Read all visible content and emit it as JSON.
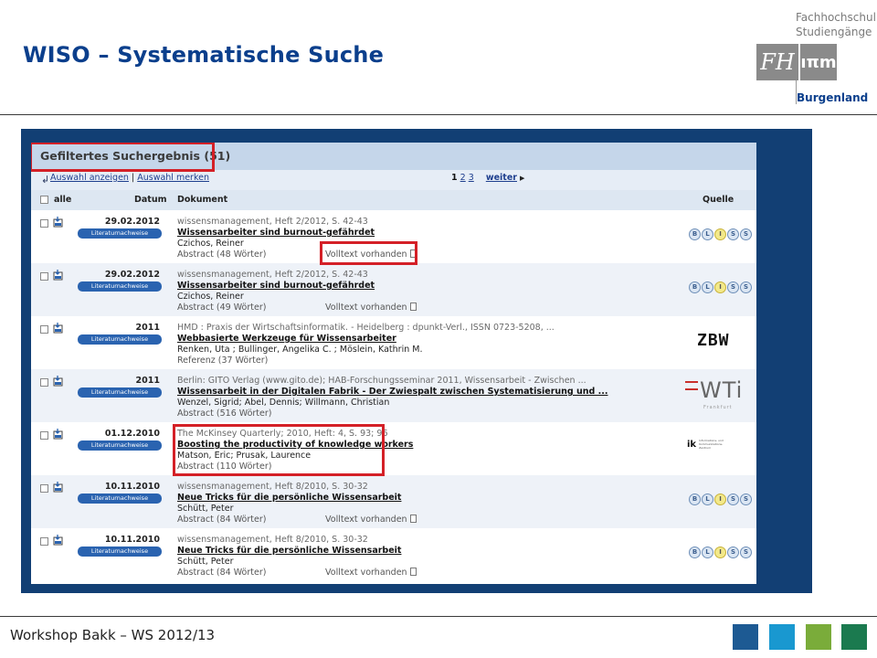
{
  "slide": {
    "title": "WISO – Systematische Suche",
    "footer": "Workshop Bakk – WS 2012/13",
    "logo": {
      "line1": "Fachhochschul",
      "line2": "Studiengänge",
      "box1": "FH",
      "box2": "ıπm",
      "line3": "Burgenland"
    },
    "footer_squares": [
      "#1d5a93",
      "#1998d0",
      "#7aac3a",
      "#1b7a4f"
    ]
  },
  "results": {
    "title": "Gefiltertes Suchergebnis (51)",
    "toolbar": {
      "show_selection": "Auswahl anzeigen",
      "separator": "|",
      "save_selection": "Auswahl merken"
    },
    "pager": {
      "current": "1",
      "page2": "2",
      "page3": "3",
      "next": "weiter"
    },
    "columns": {
      "all": "alle",
      "date": "Datum",
      "document": "Dokument",
      "source": "Quelle"
    },
    "badge": "Literaturnachweise",
    "fulltext_label": "Volltext vorhanden",
    "rows": [
      {
        "date": "29.02.2012",
        "source": "wissensmanagement, Heft 2/2012, S. 42-43",
        "title": "Wissensarbeiter sind burnout-gefährdet",
        "authors": "Czichos, Reiner",
        "abstract": "Abstract (48 Wörter)",
        "fulltext": "Volltext vorhanden",
        "quelle": "BLISS"
      },
      {
        "date": "29.02.2012",
        "source": "wissensmanagement, Heft 2/2012, S. 42-43",
        "title": "Wissensarbeiter sind burnout-gefährdet",
        "authors": "Czichos, Reiner",
        "abstract": "Abstract (49 Wörter)",
        "fulltext": "Volltext vorhanden",
        "quelle": "BLISS"
      },
      {
        "date": "2011",
        "source": "HMD : Praxis der Wirtschaftsinformatik. - Heidelberg : dpunkt-Verl., ISSN 0723-5208, ...",
        "title": "Webbasierte Werkzeuge für Wissensarbeiter",
        "authors": "Renken, Uta ; Bullinger, Angelika C. ; Möslein, Kathrin M.",
        "abstract": "Referenz (37 Wörter)",
        "fulltext": "",
        "quelle": "ZBW"
      },
      {
        "date": "2011",
        "source": "Berlin: GITO Verlag (www.gito.de); HAB-Forschungsseminar 2011, Wissensarbeit - Zwischen ...",
        "title": "Wissensarbeit in der Digitalen Fabrik - Der Zwiespalt zwischen Systematisierung und ...",
        "authors": "Wenzel, Sigrid; Abel, Dennis; Willmann, Christian",
        "abstract": "Abstract (516 Wörter)",
        "fulltext": "",
        "quelle": "WTI"
      },
      {
        "date": "01.12.2010",
        "source": "The McKinsey Quarterly; 2010, Heft: 4, S. 93; 96",
        "title": "Boosting the productivity of knowledge workers",
        "authors": "Matson, Eric; Prusak, Laurence",
        "abstract": "Abstract (110 Wörter)",
        "fulltext": "",
        "quelle": "IK"
      },
      {
        "date": "10.11.2010",
        "source": "wissensmanagement, Heft 8/2010, S. 30-32",
        "title": "Neue Tricks für die persönliche Wissensarbeit",
        "authors": "Schütt, Peter",
        "abstract": "Abstract (84 Wörter)",
        "fulltext": "Volltext vorhanden",
        "quelle": "BLISS"
      },
      {
        "date": "10.11.2010",
        "source": "wissensmanagement, Heft 8/2010, S. 30-32",
        "title": "Neue Tricks für die persönliche Wissensarbeit",
        "authors": "Schütt, Peter",
        "abstract": "Abstract (84 Wörter)",
        "fulltext": "Volltext vorhanden",
        "quelle": "BLISS"
      }
    ],
    "logos": {
      "bliss_letters": [
        "B",
        "L",
        "I",
        "S",
        "S"
      ],
      "zbw": "ZBW",
      "wti": "WTi",
      "wti_sub": "Frankfurt",
      "ik": "ik",
      "ik_sub": "Informations- und Kommunikations-Zentrum"
    }
  }
}
